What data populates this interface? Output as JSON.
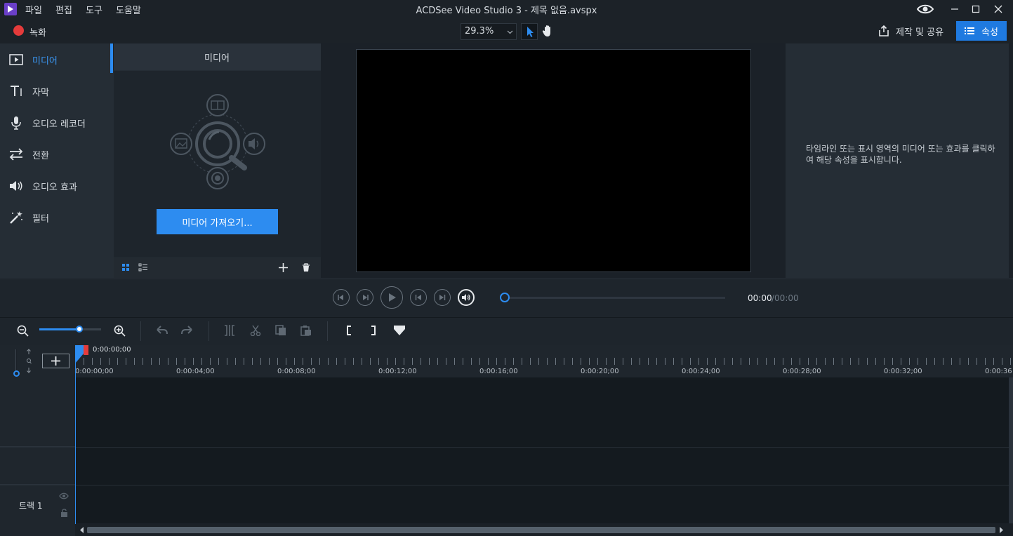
{
  "window": {
    "title": "ACDSee Video Studio 3 - 제목 없음.avspx",
    "menu": [
      "파일",
      "편집",
      "도구",
      "도움말"
    ]
  },
  "toolbar": {
    "record_label": "녹화",
    "zoom_value": "29.3%",
    "share_label": "제작 및 공유",
    "properties_label": "속성"
  },
  "sidebar": {
    "items": [
      {
        "label": "미디어",
        "icon": "play-box-icon",
        "active": true
      },
      {
        "label": "자막",
        "icon": "text-icon",
        "active": false
      },
      {
        "label": "오디오 레코더",
        "icon": "microphone-icon",
        "active": false
      },
      {
        "label": "전환",
        "icon": "swap-arrows-icon",
        "active": false
      },
      {
        "label": "오디오 효과",
        "icon": "speaker-icon",
        "active": false
      },
      {
        "label": "필터",
        "icon": "magic-wand-icon",
        "active": false
      }
    ]
  },
  "media_panel": {
    "title": "미디어",
    "import_label": "미디어 가져오기..."
  },
  "properties_panel": {
    "hint": "타임라인 또는 표시 영역의 미디어 또는 효과를 클릭하여 해당 속성을 표시합니다."
  },
  "transport": {
    "time_current": "00:00",
    "time_total": "/00:00"
  },
  "timeline": {
    "playhead_time": "0:00:00;00",
    "ticks": [
      "0:00:00;00",
      "0:00:04;00",
      "0:00:08;00",
      "0:00:12;00",
      "0:00:16;00",
      "0:00:20;00",
      "0:00:24;00",
      "0:00:28;00",
      "0:00:32;00",
      "0:00:36"
    ],
    "track_label": "트랙 1"
  },
  "colors": {
    "accent": "#2d8cf0",
    "record": "#e43b3b",
    "background": "#1b2128",
    "panel": "#252d35"
  }
}
